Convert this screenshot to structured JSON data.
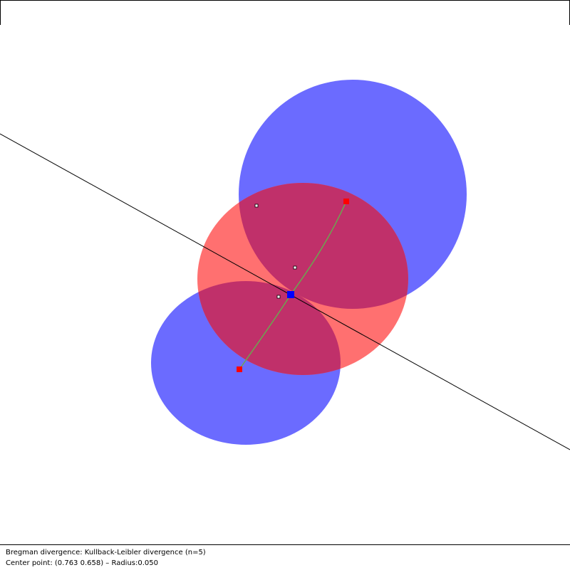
{
  "status": {
    "divergence_line": "Bregman divergence: Kullback-Leibler divergence (n=5)",
    "center_line": "Center point: (0.763 0.658) –  Radius:0.050"
  },
  "colors": {
    "blue_ball": "#6b6bff",
    "red_ball": "#ff7070",
    "overlap": "#c0306a",
    "geodesic": "#6aa84f",
    "endpoint_marker": "#ff0000",
    "center_marker": "#0000ff",
    "line": "#000000"
  },
  "icons": {
    "endpoint": "red-square-handle",
    "center": "blue-square-handle",
    "sample_point": "small-hollow-square"
  }
}
